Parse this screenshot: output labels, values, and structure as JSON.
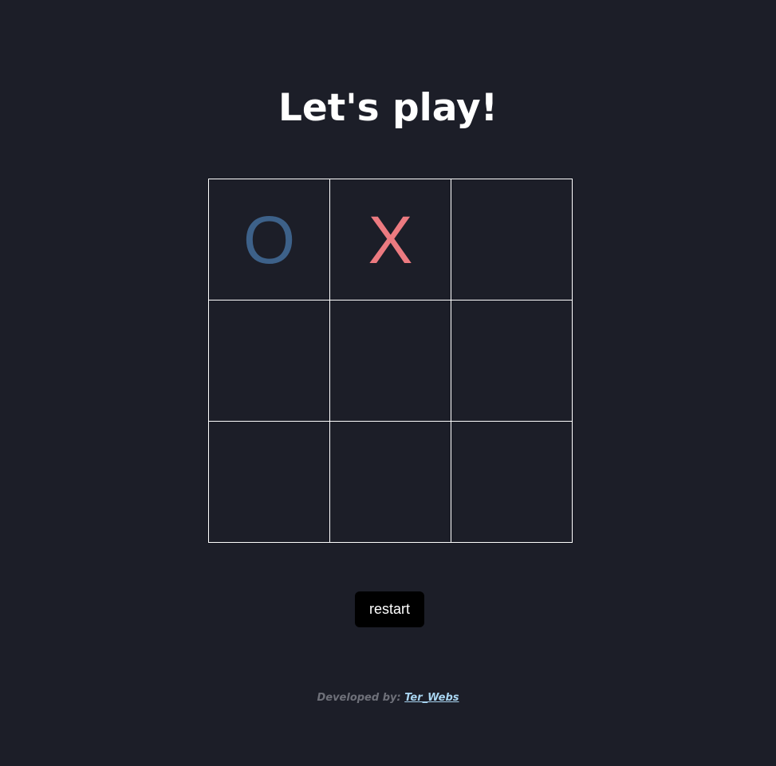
{
  "title": "Let's play!",
  "board": {
    "cells": [
      "O",
      "X",
      "",
      "",
      "",
      "",
      "",
      "",
      ""
    ]
  },
  "restart_label": "restart",
  "footer": {
    "prefix": "Developed by:",
    "author": "Ter_Webs"
  },
  "colors": {
    "background": "#1c1e28",
    "o_mark": "#3d6189",
    "x_mark": "#ec7a80",
    "grid": "#ffffff",
    "link": "#a8d4f0"
  }
}
